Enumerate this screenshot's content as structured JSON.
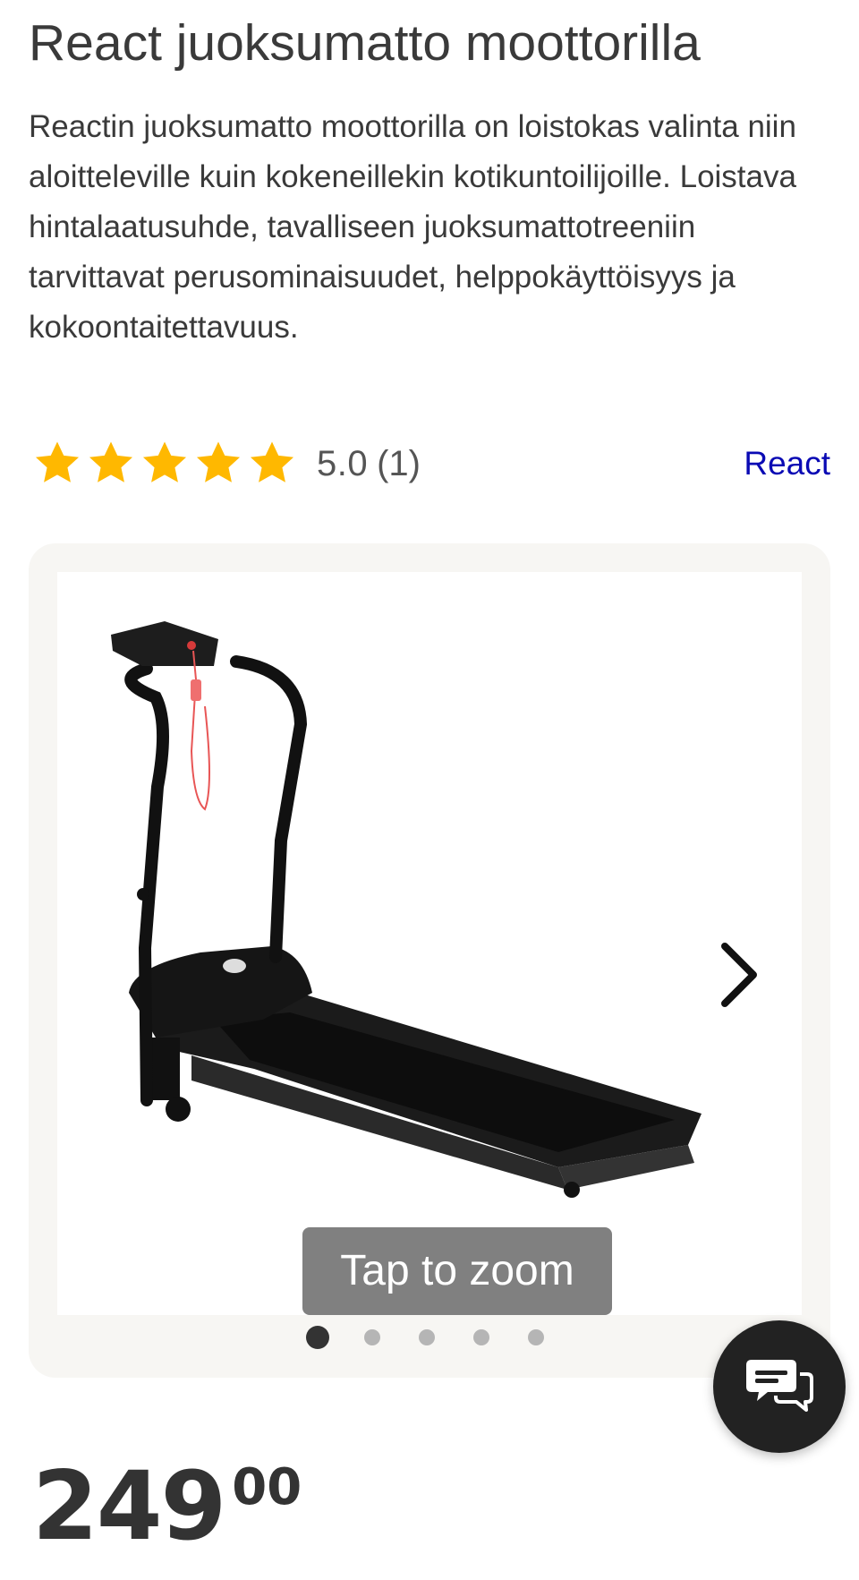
{
  "product": {
    "title": "React juoksumatto moottorilla",
    "description": "Reactin juoksumatto moottorilla on loistokas valinta niin aloitteleville kuin kokeneillekin kotikuntoilijoille. Loistava hintalaatusuhde, tavalliseen juoksumattotreeniin tarvittavat perusominaisuudet, helppokäyttöisyys ja kokoontaitettavuus.",
    "brand": "React"
  },
  "rating": {
    "value": "5.0",
    "count": "(1)",
    "stars": 5,
    "star_color": "#FFB800"
  },
  "gallery": {
    "zoom_hint": "Tap to zoom",
    "image_count": 5,
    "active_index": 0
  },
  "price": {
    "main": "249",
    "cents": "00"
  },
  "colors": {
    "brand_link": "#0a0ab4",
    "chat_button": "#222222",
    "gallery_background": "#f7f6f3"
  }
}
